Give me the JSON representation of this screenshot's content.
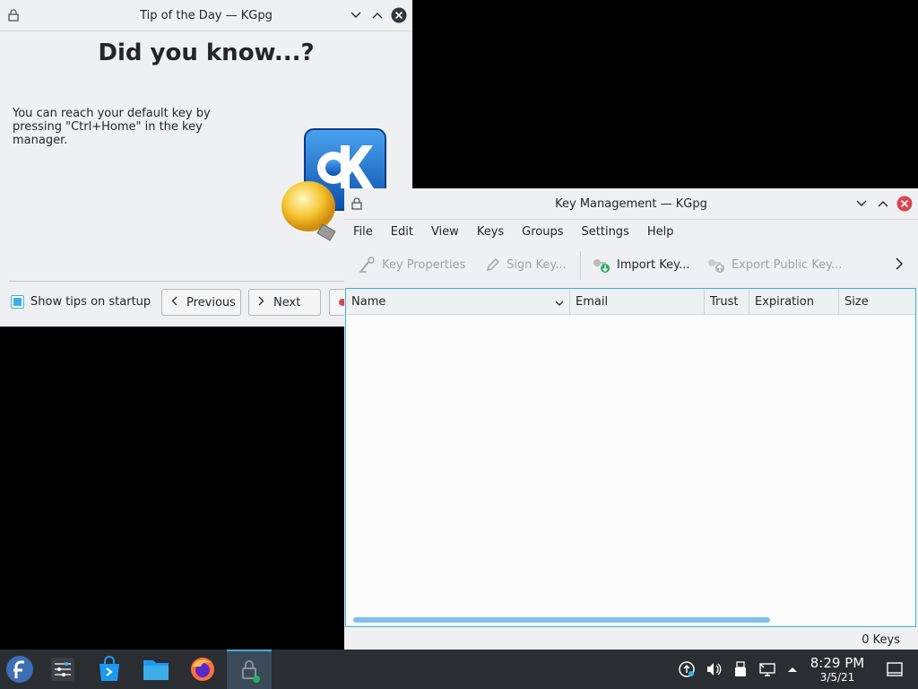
{
  "tip_window": {
    "title": "Tip of the Day — KGpg",
    "heading": "Did you know...?",
    "tip_text": "You can reach your default key by pressing \"Ctrl+Home\" in the key manager.",
    "show_tips_label": "Show tips on startup",
    "show_tips_checked": true,
    "previous_label": "Previous",
    "next_label": "Next"
  },
  "key_window": {
    "title": "Key Management — KGpg",
    "menu": [
      "File",
      "Edit",
      "View",
      "Keys",
      "Groups",
      "Settings",
      "Help"
    ],
    "toolbar": {
      "key_properties": "Key Properties",
      "sign_key": "Sign Key...",
      "import_key": "Import Key...",
      "export_public_key": "Export Public Key..."
    },
    "columns": [
      "Name",
      "Email",
      "Trust",
      "Expiration",
      "Size"
    ],
    "status": "0 Keys"
  },
  "taskbar": {
    "time": "8:29 PM",
    "date": "3/5/21",
    "icons": [
      "fedora-icon",
      "settings-icon",
      "discover-icon",
      "files-icon",
      "firefox-icon",
      "kgpg-icon"
    ]
  },
  "colors": {
    "accent": "#3daee9",
    "close_red": "#da4453",
    "taskbar": "#2a2e32"
  }
}
